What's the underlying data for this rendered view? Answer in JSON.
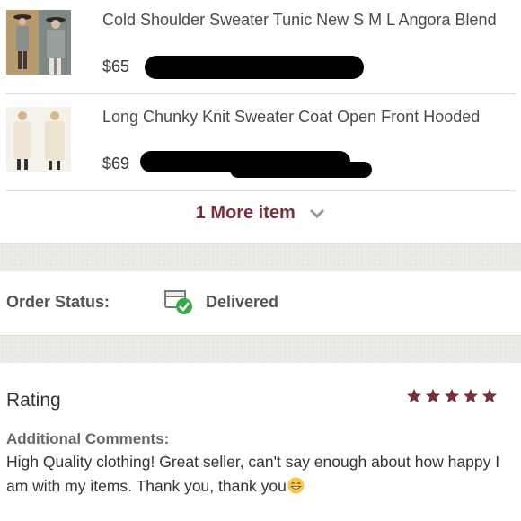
{
  "items": [
    {
      "title": "Cold Shoulder Sweater Tunic New S M L Angora Blend",
      "price": "$65"
    },
    {
      "title": "Long Chunky Knit Sweater Coat Open Front Hooded",
      "price": "$69"
    }
  ],
  "more_items_label": "1 More item",
  "order_status": {
    "label": "Order Status:",
    "value": "Delivered"
  },
  "rating": {
    "label": "Rating",
    "stars": 5
  },
  "comments": {
    "label": "Additional Comments:",
    "text": "High Quality clothing! Great seller, can't say enough about how happy I am with my items. Thank you, thank you"
  },
  "colors": {
    "accent": "#7b2d3b",
    "star": "#7b2d3b",
    "status_check": "#3aa84a"
  },
  "icons": [
    "chevron-down-icon",
    "box-check-icon",
    "star-icon",
    "grin-emoji-icon"
  ]
}
